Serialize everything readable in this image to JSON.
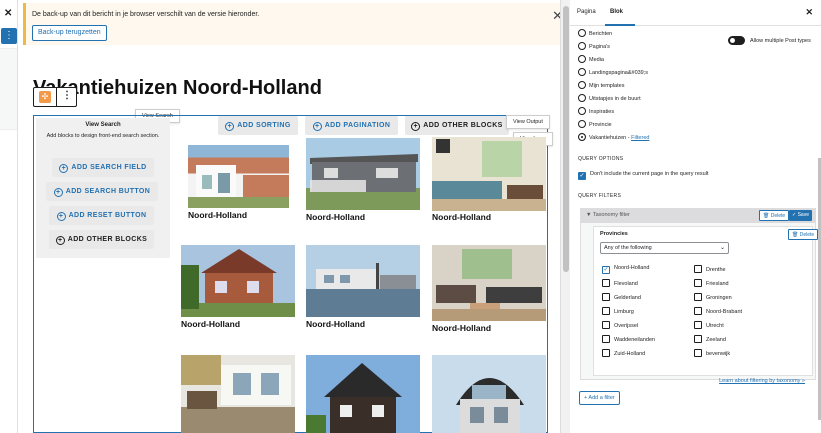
{
  "notice": {
    "message": "De back-up van dit bericht in je browser verschilt van de versie hieronder.",
    "restore_label": "Back-up terugzetten"
  },
  "editor": {
    "title": "Vakantiehuizen Noord-Holland"
  },
  "tooltips": {
    "view_search": "View Search",
    "view_output": "View Output",
    "view_loop": "View Loop"
  },
  "search_panel": {
    "title": "View Search",
    "subtitle": "Add blocks to design front-end search section.",
    "buttons": [
      "ADD SEARCH FIELD",
      "ADD SEARCH BUTTON",
      "ADD RESET BUTTON",
      "ADD OTHER BLOCKS"
    ]
  },
  "output_toolbar": {
    "sorting": "ADD SORTING",
    "pagination": "ADD PAGINATION",
    "other": "ADD OTHER BLOCKS"
  },
  "cards": [
    {
      "caption": "Noord-Holland",
      "scene": "white-house"
    },
    {
      "caption": "Noord-Holland",
      "scene": "chalet"
    },
    {
      "caption": "Noord-Holland",
      "scene": "interior"
    },
    {
      "caption": "Noord-Holland",
      "scene": "brick-house"
    },
    {
      "caption": "Noord-Holland",
      "scene": "houseboat"
    },
    {
      "caption": "Noord-Holland",
      "scene": "living-room"
    },
    {
      "caption": "",
      "scene": "terrace"
    },
    {
      "caption": "",
      "scene": "dark-house"
    },
    {
      "caption": "",
      "scene": "round-roof"
    }
  ],
  "sidebar": {
    "tabs": [
      "Pagina",
      "Blok"
    ],
    "active_tab": "Blok",
    "post_types": [
      {
        "label": "Berichten",
        "checked": false
      },
      {
        "label": "Pagina's",
        "checked": false
      },
      {
        "label": "Media",
        "checked": false
      },
      {
        "label": "Landingspagina&#039;s",
        "checked": false
      },
      {
        "label": "Mijn templates",
        "checked": false
      },
      {
        "label": "Uitstapjes in de buurt",
        "checked": false
      },
      {
        "label": "Inspiraties",
        "checked": false
      },
      {
        "label": "Provincie",
        "checked": false
      },
      {
        "label": "Vakantiehuizen",
        "checked": true,
        "link": "Filtered"
      }
    ],
    "toggle_label": "Allow multiple Post types",
    "query_options_heading": "QUERY OPTIONS",
    "exclude_current_label": "Don't include the current page in the query result",
    "query_filters_heading": "QUERY FILTERS",
    "filter": {
      "title": "Taxonomy filter",
      "delete_label": "Delete",
      "save_label": "Save",
      "taxonomy": "Provincies",
      "taxonomy_delete_label": "Delete",
      "match_mode": "Any of the following",
      "terms": [
        {
          "label": "Noord-Holland",
          "checked": true
        },
        {
          "label": "Drenthe",
          "checked": false
        },
        {
          "label": "Flevoland",
          "checked": false
        },
        {
          "label": "Friesland",
          "checked": false
        },
        {
          "label": "Gelderland",
          "checked": false
        },
        {
          "label": "Groningen",
          "checked": false
        },
        {
          "label": "Limburg",
          "checked": false
        },
        {
          "label": "Noord-Brabant",
          "checked": false
        },
        {
          "label": "Overijssel",
          "checked": false
        },
        {
          "label": "Utrecht",
          "checked": false
        },
        {
          "label": "Waddeneilanden",
          "checked": false
        },
        {
          "label": "Zeeland",
          "checked": false
        },
        {
          "label": "Zuid-Holland",
          "checked": false
        },
        {
          "label": "bevenwijk",
          "checked": false
        }
      ],
      "learn_more": "Learn about filtering by taxonomy »"
    },
    "add_filter_label": "+ Add a filter"
  }
}
